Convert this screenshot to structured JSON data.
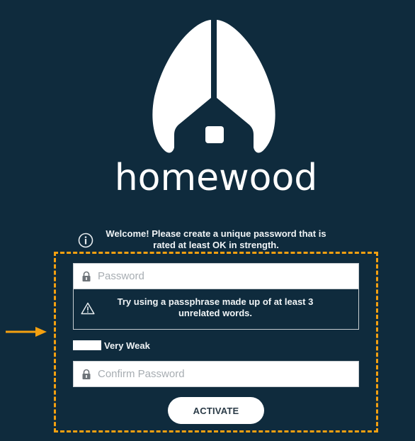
{
  "brand": {
    "name": "homewood",
    "logo_icon": "homewood-logo-icon"
  },
  "welcome": {
    "icon": "info-icon",
    "message": "Welcome! Please create a unique password that is rated at least OK in strength."
  },
  "form": {
    "password": {
      "icon": "lock-icon",
      "placeholder": "Password",
      "value": ""
    },
    "hint": {
      "icon": "warning-icon",
      "text": "Try using a passphrase made up of at least 3 unrelated words."
    },
    "strength": {
      "label": "Very Weak",
      "level_fraction": 0.2
    },
    "confirm_password": {
      "icon": "lock-icon",
      "placeholder": "Confirm Password",
      "value": ""
    },
    "submit_label": "ACTIVATE"
  },
  "annotation": {
    "highlight_color": "#f5a010",
    "arrow_icon": "arrow-right-icon"
  },
  "colors": {
    "background": "#0f2b3d",
    "foreground": "#ffffff"
  }
}
